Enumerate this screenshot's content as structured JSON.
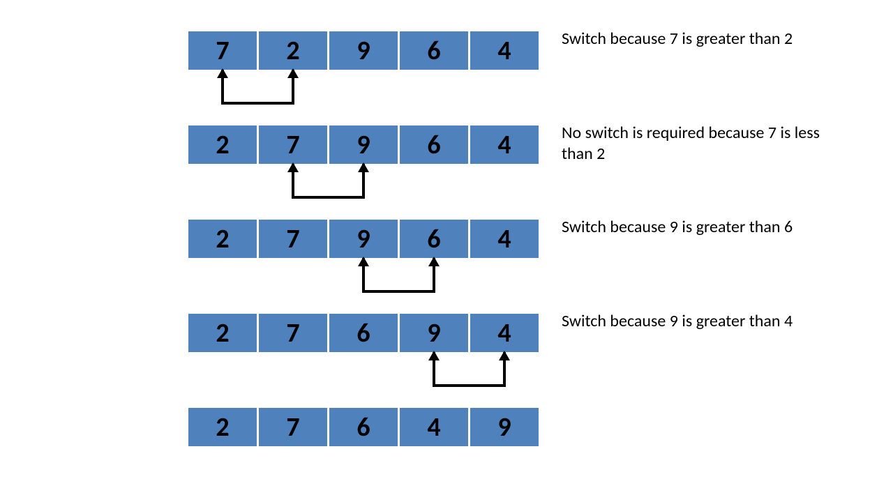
{
  "cell_color": "#4f81bd",
  "steps": [
    {
      "values": [
        7,
        2,
        9,
        6,
        4
      ],
      "swap_indices": [
        0,
        1
      ],
      "caption": "Switch because 7 is greater than 2"
    },
    {
      "values": [
        2,
        7,
        9,
        6,
        4
      ],
      "swap_indices": [
        1,
        2
      ],
      "caption": "No switch is required because 7 is less than 2"
    },
    {
      "values": [
        2,
        7,
        9,
        6,
        4
      ],
      "swap_indices": [
        2,
        3
      ],
      "caption": "Switch because 9 is greater than 6"
    },
    {
      "values": [
        2,
        7,
        6,
        9,
        4
      ],
      "swap_indices": [
        3,
        4
      ],
      "caption": "Switch because 9 is greater than 4"
    },
    {
      "values": [
        2,
        7,
        6,
        4,
        9
      ],
      "swap_indices": null,
      "caption": null
    }
  ]
}
